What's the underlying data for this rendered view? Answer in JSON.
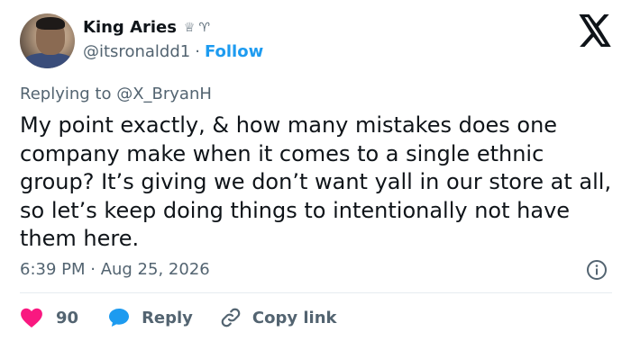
{
  "author": {
    "display_name": "King Aries",
    "badge_glyph": "♕",
    "sign_glyph": "♈︎",
    "handle": "@itsronaldd1",
    "separator": "·",
    "follow_label": "Follow"
  },
  "reply_context": {
    "prefix": "Replying to ",
    "mention": "@X_BryanH"
  },
  "tweet": {
    "text": "My point exactly, & how many mistakes does one company make when it comes to a single ethnic group? It’s giving we don’t want yall in our store at all, so let’s keep doing things to intentionally not have them here.",
    "timestamp": "6:39 PM · Aug 25, 2026"
  },
  "actions": {
    "like_count": "90",
    "reply_label": "Reply",
    "copy_link_label": "Copy link"
  },
  "icons": {
    "logo": "x-logo-icon",
    "info": "info-icon",
    "like": "heart-icon",
    "reply": "speech-bubble-icon",
    "copy": "link-icon"
  },
  "colors": {
    "text": "#0f1419",
    "secondary": "#536471",
    "link": "#1d9bf0",
    "heart": "#f91880",
    "reply_bubble": "#1d9bf0",
    "divider": "#e6ecf0"
  }
}
